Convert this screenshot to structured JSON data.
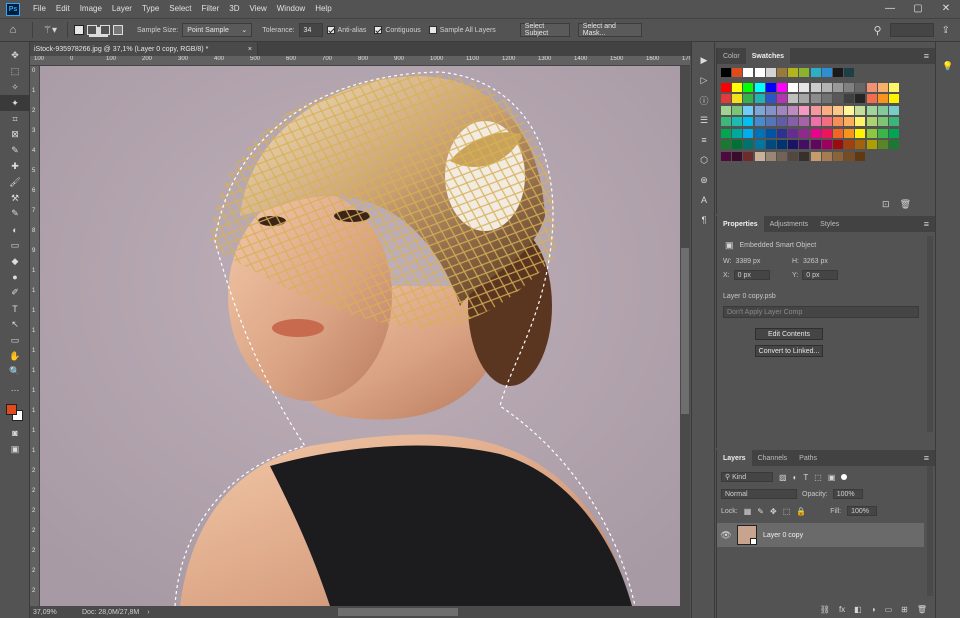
{
  "menu": {
    "logo": "Ps",
    "items": [
      "File",
      "Edit",
      "Image",
      "Layer",
      "Type",
      "Select",
      "Filter",
      "3D",
      "View",
      "Window",
      "Help"
    ],
    "window_controls": [
      "—",
      "▢",
      "✕"
    ]
  },
  "options": {
    "sample_size_label": "Sample Size:",
    "sample_size_value": "Point Sample",
    "tolerance_label": "Tolerance:",
    "tolerance_value": "34",
    "anti_alias": "Anti-alias",
    "contiguous": "Contiguous",
    "sample_all_layers": "Sample All Layers",
    "select_subject": "Select Subject",
    "select_and_mask": "Select and Mask..."
  },
  "document": {
    "tab_title": "iStock-935978266.jpg @ 37,1% (Layer 0 copy, RGB/8) *",
    "tab_close": "×",
    "zoom": "37,09%",
    "doc_info": "Doc: 28,0M/27,8M",
    "status_arrow": "›",
    "ruler_top_marks": [
      "100",
      "0",
      "100",
      "200",
      "300",
      "400",
      "500",
      "600",
      "700",
      "800",
      "900",
      "1000",
      "1100",
      "1200",
      "1300",
      "1400",
      "1500",
      "1600",
      "1700"
    ],
    "ruler_left_marks": [
      "0",
      "1",
      "2",
      "3",
      "4",
      "5",
      "6",
      "7",
      "8",
      "9",
      "1",
      "1",
      "1",
      "1",
      "1",
      "1",
      "1",
      "1",
      "1",
      "1",
      "2",
      "2",
      "2",
      "2",
      "2",
      "2",
      "2"
    ]
  },
  "tools": [
    "✥",
    "⬚",
    "✧",
    "✦",
    "⌗",
    "⊠",
    "✎",
    "✚",
    "🖌",
    "⚒",
    "✎",
    "◐",
    "▭",
    "◆",
    "●",
    "✐",
    "T",
    "↖",
    "▭",
    "✋",
    "🔍",
    "…"
  ],
  "icon_column": [
    "▶",
    "▷",
    "ⓘ",
    "☰",
    "≡",
    "⬡",
    "⊛",
    "A",
    "¶"
  ],
  "swatches_panel": {
    "tabs": [
      "Color",
      "Swatches"
    ],
    "rows": [
      [
        "#000000",
        "#e04b1e",
        "#ffffff",
        "#ffffff",
        "#d4d4d4",
        "#9a7a3c",
        "#b3b31f",
        "#8cb32e",
        "#2cb0c8",
        "#2e8ed3",
        "#1a1a1a",
        "#1e3f44"
      ],
      [
        "#ff0000",
        "#ffff00",
        "#00ff00",
        "#00ffff",
        "#0000ff",
        "#ff00ff",
        "#ffffff",
        "#e6e6e6",
        "#cccccc",
        "#b3b3b3",
        "#999999",
        "#808080",
        "#666666",
        "#f19275",
        "#f7b16b",
        "#fff568"
      ],
      [
        "#e03a3a",
        "#f2e21c",
        "#33b34a",
        "#1fb3b3",
        "#2e55c7",
        "#b335b3",
        "#bfbfbf",
        "#a6a6a6",
        "#8c8c8c",
        "#737373",
        "#595959",
        "#404040",
        "#262626",
        "#f26c4f",
        "#f7941d",
        "#fff200"
      ],
      [
        "#a1d490",
        "#7cc576",
        "#6dcff6",
        "#7da7d9",
        "#8393ca",
        "#a186be",
        "#bd8cbf",
        "#f49ac1",
        "#f5989d",
        "#f9ad81",
        "#fdc689",
        "#fff799",
        "#c4df9b",
        "#a3d39c",
        "#82ca9c",
        "#7accc8"
      ],
      [
        "#3cb878",
        "#1cbbb4",
        "#00bff3",
        "#448ccb",
        "#5674b9",
        "#605ca8",
        "#855fa8",
        "#a763a8",
        "#f06eaa",
        "#f26d7d",
        "#f68e56",
        "#fbaf5d",
        "#fff467",
        "#acd372",
        "#7dc473",
        "#39b778"
      ],
      [
        "#00a651",
        "#00a99d",
        "#00aeef",
        "#0072bc",
        "#0054a6",
        "#2e3192",
        "#662d91",
        "#92278f",
        "#ec008c",
        "#ed145b",
        "#f26522",
        "#f7941d",
        "#fff200",
        "#8dc63f",
        "#39b54a",
        "#00a651"
      ],
      [
        "#197b30",
        "#007236",
        "#00746b",
        "#0076a3",
        "#004a80",
        "#003471",
        "#1b1464",
        "#440e62",
        "#630460",
        "#9e005d",
        "#9e0b0f",
        "#a0410d",
        "#a36209",
        "#aba000",
        "#598527",
        "#1a7b30"
      ],
      [
        "#4c0b3c",
        "#3a0c2c",
        "#6e2b2b",
        "#c7b299",
        "#998675",
        "#736357",
        "#534741",
        "#37302d",
        "#c69c6d",
        "#a67c52",
        "#8c6239",
        "#754c24",
        "#603913"
      ]
    ]
  },
  "properties_panel": {
    "tabs": [
      "Properties",
      "Adjustments",
      "Styles"
    ],
    "object_type": "Embedded Smart Object",
    "w_label": "W:",
    "w_value": "3389 px",
    "h_label": "H:",
    "h_value": "3263 px",
    "x_label": "X:",
    "x_value": "0 px",
    "y_label": "Y:",
    "y_value": "0 px",
    "file_name": "Layer 0 copy.psb",
    "layer_comp": "Don't Apply Layer Comp",
    "edit_contents": "Edit Contents",
    "convert_to_linked": "Convert to Linked..."
  },
  "layers_panel": {
    "tabs": [
      "Layers",
      "Channels",
      "Paths"
    ],
    "kind_label": "Kind",
    "blend_mode": "Normal",
    "opacity_label": "Opacity:",
    "opacity_value": "100%",
    "lock_label": "Lock:",
    "fill_label": "Fill:",
    "fill_value": "100%",
    "layers": [
      {
        "name": "Layer 0 copy"
      }
    ],
    "footer_icons": [
      "⛓",
      "fx",
      "◧",
      "◑",
      "▭",
      "⊞",
      "🗑"
    ]
  },
  "colors": {
    "accent": "#31a8ff",
    "foreground": "#e04b1e",
    "background": "#ffffff",
    "canvas_bg": "#b5a6b0"
  }
}
